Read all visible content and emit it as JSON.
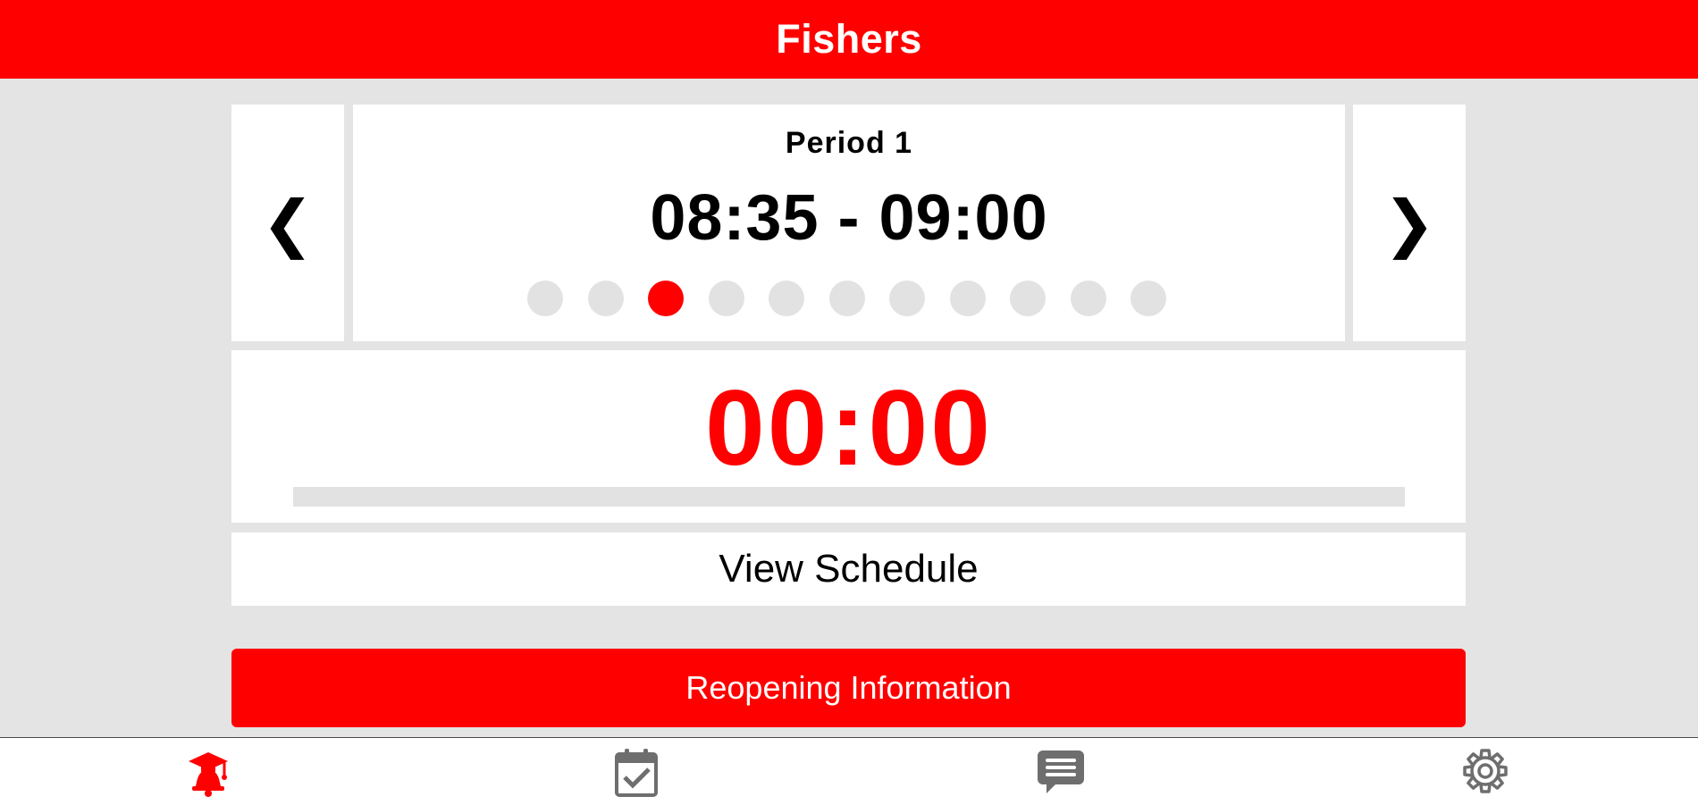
{
  "header": {
    "title": "Fishers"
  },
  "period": {
    "name": "Period 1",
    "time_range": "08:35 - 09:00",
    "prev_icon": "chevron-left-icon",
    "next_icon": "chevron-right-icon",
    "prev_glyph": "❮",
    "next_glyph": "❯",
    "page_count": 11,
    "active_page_index": 2
  },
  "timer": {
    "value": "00:00",
    "progress_fraction": 0
  },
  "schedule": {
    "label": "View Schedule"
  },
  "reopen": {
    "label": "Reopening Information"
  },
  "tabbar": {
    "tabs": [
      {
        "icon": "school-bell-icon",
        "active": true
      },
      {
        "icon": "calendar-check-icon",
        "active": false
      },
      {
        "icon": "chat-bubble-icon",
        "active": false
      },
      {
        "icon": "gear-icon",
        "active": false
      }
    ]
  },
  "colors": {
    "accent": "#ff0000",
    "background": "#e4e4e4",
    "panel": "#ffffff",
    "inactive_dot": "#e2e2e2",
    "icon_inactive": "#6e6e6e"
  }
}
